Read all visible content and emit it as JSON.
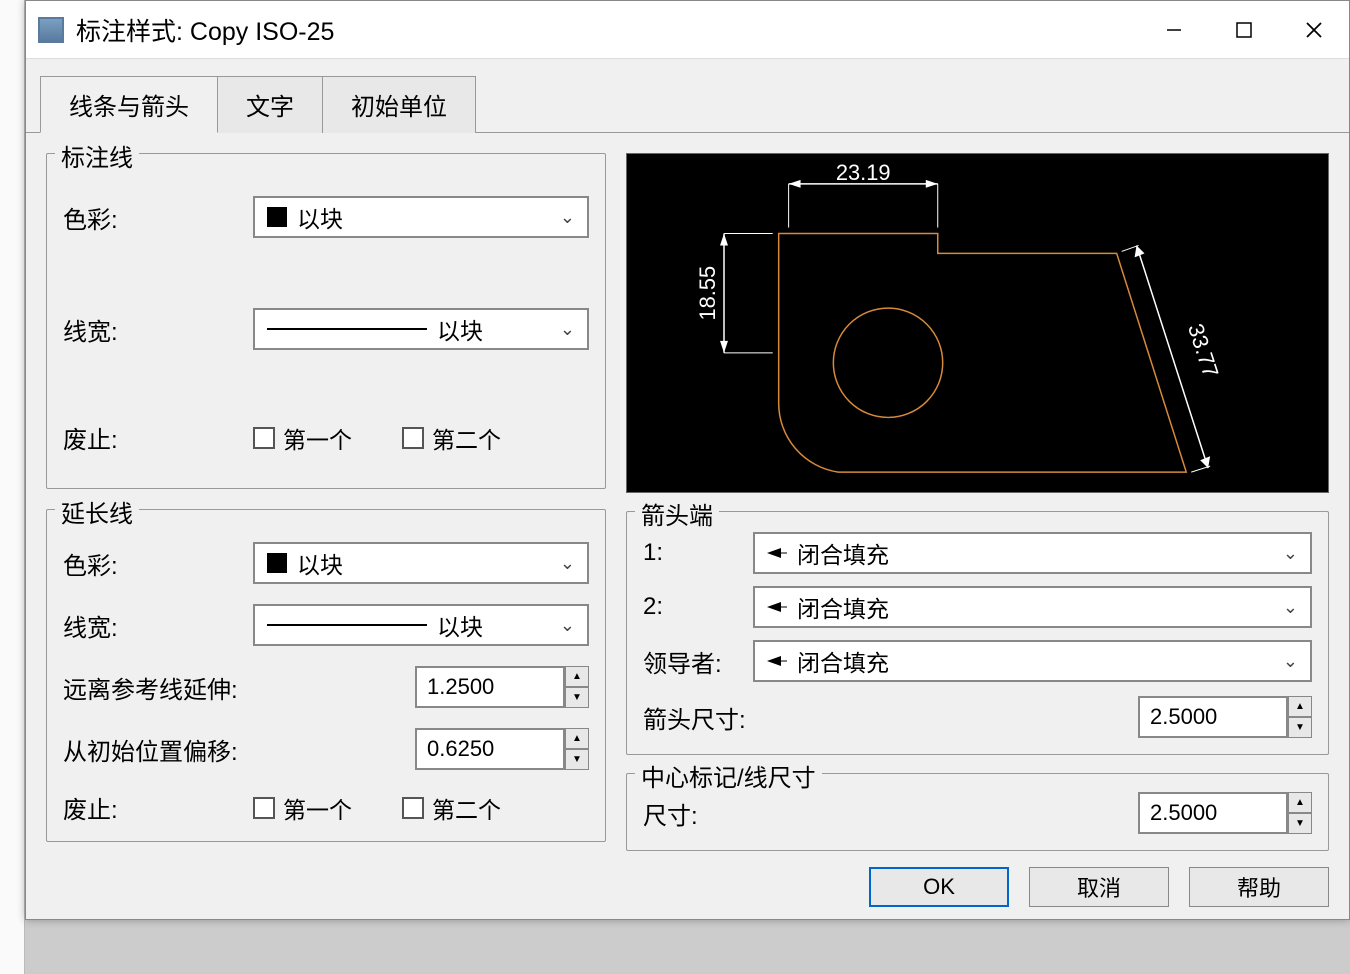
{
  "window": {
    "title": "标注样式: Copy ISO-25"
  },
  "tabs": {
    "lines_arrows": "线条与箭头",
    "text": "文字",
    "primary_units": "初始单位"
  },
  "dim_line": {
    "legend": "标注线",
    "color_label": "色彩:",
    "color_value": "以块",
    "lineweight_label": "线宽:",
    "lineweight_value": "以块",
    "suppress_label": "废止:",
    "check1": "第一个",
    "check2": "第二个"
  },
  "ext_line": {
    "legend": "延长线",
    "color_label": "色彩:",
    "color_value": "以块",
    "lineweight_label": "线宽:",
    "lineweight_value": "以块",
    "extend_label": "远离参考线延伸:",
    "extend_value": "1.2500",
    "offset_label": "从初始位置偏移:",
    "offset_value": "0.6250",
    "suppress_label": "废止:",
    "check1": "第一个",
    "check2": "第二个"
  },
  "arrowheads": {
    "legend": "箭头端",
    "first_label": "1:",
    "first_value": "闭合填充",
    "second_label": "2:",
    "second_value": "闭合填充",
    "leader_label": "领导者:",
    "leader_value": "闭合填充",
    "size_label": "箭头尺寸:",
    "size_value": "2.5000"
  },
  "center_mark": {
    "legend": "中心标记/线尺寸",
    "size_label": "尺寸:",
    "size_value": "2.5000"
  },
  "preview": {
    "dim1": "23.19",
    "dim2": "18.55",
    "dim3": "33.77"
  },
  "footer": {
    "ok": "OK",
    "cancel": "取消",
    "help": "帮助"
  }
}
